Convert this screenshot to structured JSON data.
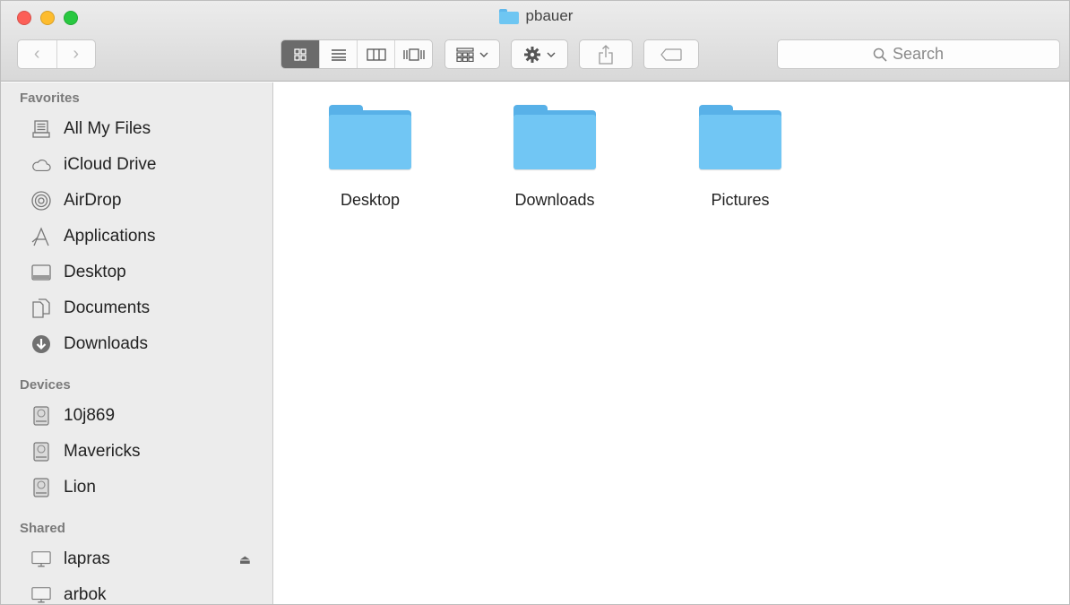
{
  "window": {
    "title": "pbauer"
  },
  "toolbar": {
    "back_glyph": "‹",
    "forward_glyph": "›",
    "search_placeholder": "Search",
    "icons": [
      "icon-view-icon",
      "list-view-icon",
      "column-view-icon",
      "coverflow-view-icon",
      "arrange-icon",
      "gear-icon",
      "share-icon",
      "tag-icon",
      "search-icon"
    ]
  },
  "sidebar": {
    "favorites_heading": "Favorites",
    "favorites": [
      {
        "label": "All My Files",
        "icon": "all-files-icon"
      },
      {
        "label": "iCloud Drive",
        "icon": "cloud-icon"
      },
      {
        "label": "AirDrop",
        "icon": "airdrop-icon"
      },
      {
        "label": "Applications",
        "icon": "applications-icon"
      },
      {
        "label": "Desktop",
        "icon": "desktop-icon"
      },
      {
        "label": "Documents",
        "icon": "documents-icon"
      },
      {
        "label": "Downloads",
        "icon": "downloads-icon"
      }
    ],
    "devices_heading": "Devices",
    "devices": [
      {
        "label": "10j869",
        "icon": "disk-icon"
      },
      {
        "label": "Mavericks",
        "icon": "disk-icon"
      },
      {
        "label": "Lion",
        "icon": "disk-icon"
      }
    ],
    "shared_heading": "Shared",
    "shared": [
      {
        "label": "lapras",
        "icon": "display-icon",
        "eject": "⏏"
      },
      {
        "label": "arbok",
        "icon": "display-icon"
      }
    ]
  },
  "content": {
    "items": [
      {
        "label": "Desktop"
      },
      {
        "label": "Downloads"
      },
      {
        "label": "Pictures"
      }
    ]
  },
  "colors": {
    "folder_front": "#71c6f4",
    "folder_back": "#58b1e8",
    "sidebar_bg": "#ececec"
  }
}
